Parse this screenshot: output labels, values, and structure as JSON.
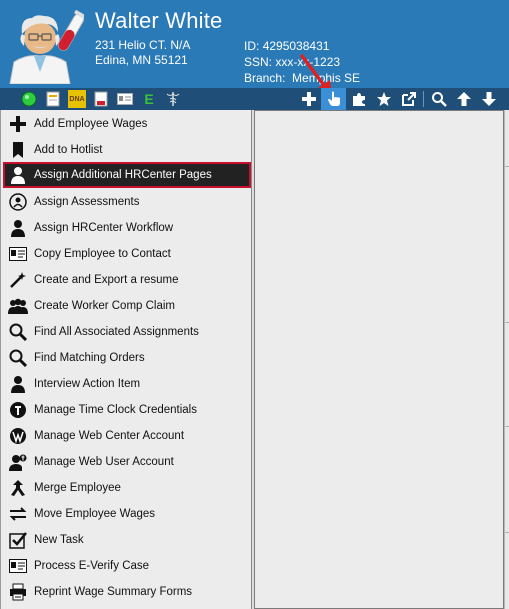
{
  "employee": {
    "name": "Walter White",
    "address_line1": "231 Helio CT. N/A",
    "address_line2": "Edina, MN 55121",
    "id_label": "ID:",
    "id_value": "4295038431",
    "ssn_label": "SSN:",
    "ssn_value": "xxx-xx-1223",
    "branch_label": "Branch:",
    "branch_value": "Memphis SE"
  },
  "toolbar": {
    "status_icons": [
      "green-status-icon",
      "document-icon",
      "dna-icon",
      "pdf-icon",
      "id-card-icon",
      "e-verify-icon",
      "caduceus-icon"
    ],
    "dna_text": "DNA",
    "everify_text": "E",
    "action_icons": [
      "add-icon",
      "hand-pointer-icon",
      "puzzle-icon",
      "star-icon",
      "external-link-icon",
      "search-icon",
      "arrow-up-icon",
      "arrow-down-icon"
    ]
  },
  "menu": {
    "items": [
      {
        "label": "Add Employee Wages",
        "icon": "plus-icon"
      },
      {
        "label": "Add to Hotlist",
        "icon": "bookmark-icon"
      },
      {
        "label": "Assign Additional HRCenter Pages",
        "icon": "person-icon"
      },
      {
        "label": "Assign Assessments",
        "icon": "assessment-icon"
      },
      {
        "label": "Assign HRCenter Workflow",
        "icon": "person-icon"
      },
      {
        "label": "Copy Employee to Contact",
        "icon": "contact-card-icon"
      },
      {
        "label": "Create and Export a resume",
        "icon": "magic-wand-icon"
      },
      {
        "label": "Create Worker Comp Claim",
        "icon": "group-icon"
      },
      {
        "label": "Find All Associated Assignments",
        "icon": "search-icon"
      },
      {
        "label": "Find Matching Orders",
        "icon": "search-icon"
      },
      {
        "label": "Interview Action Item",
        "icon": "person-icon"
      },
      {
        "label": "Manage Time Clock Credentials",
        "icon": "time-clock-icon"
      },
      {
        "label": "Manage Web Center Account",
        "icon": "web-center-icon"
      },
      {
        "label": "Manage Web User Account",
        "icon": "web-user-icon"
      },
      {
        "label": "Merge Employee",
        "icon": "merge-icon"
      },
      {
        "label": "Move Employee Wages",
        "icon": "transfer-arrows-icon"
      },
      {
        "label": "New Task",
        "icon": "checkbox-icon"
      },
      {
        "label": "Process E-Verify Case",
        "icon": "id-card-icon"
      },
      {
        "label": "Reprint Wage Summary Forms",
        "icon": "printer-icon"
      }
    ],
    "selected_index": 2
  },
  "colors": {
    "header_bg": "#2a7ab8",
    "toolbar_bg": "#1f4e79",
    "selection_outline": "#c8102e",
    "annotation_arrow": "#e02020"
  }
}
